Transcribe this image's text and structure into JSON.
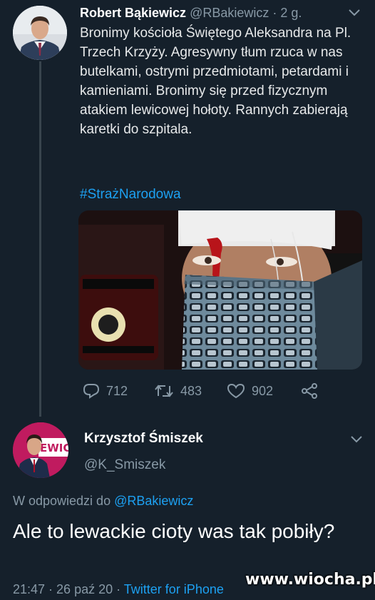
{
  "tweet": {
    "author_name": "Robert Bąkiewicz",
    "author_handle": "@RBakiewicz",
    "separator": "·",
    "time_ago": "2 g.",
    "text": "Bronimy kościoła Świętego Aleksandra na Pl. Trzech Krzyży. Agresywny tłum rzuca w nas butelkami, ostrymi przedmiotami, petardami i kamieniami. Bronimy się przed fizycznym atakiem lewicowej hołoty. Rannych zabierają karetki do szpitala.",
    "hashtag": "#StrażNarodowa",
    "reply_count": "712",
    "retweet_count": "483",
    "like_count": "902"
  },
  "reply": {
    "author_name": "Krzysztof Śmiszek",
    "author_handle": "@K_Smiszek",
    "avatar_banner_text": "EWICA",
    "replying_to_label": "W odpowiedzi do",
    "replying_to_handle": "@RBakiewicz",
    "text": "Ale to lewackie cioty was tak pobiły?",
    "timestamp": "21:47 · 26 paź 20 ·",
    "source": "Twitter for iPhone"
  },
  "watermark": "www.wiocha.pl",
  "colors": {
    "background": "#15202b",
    "secondary_text": "#8899a6",
    "accent": "#1da1f2",
    "divider": "#38444d"
  },
  "icons": [
    "chevron-down-icon",
    "reply-icon",
    "retweet-icon",
    "like-icon",
    "share-icon"
  ]
}
